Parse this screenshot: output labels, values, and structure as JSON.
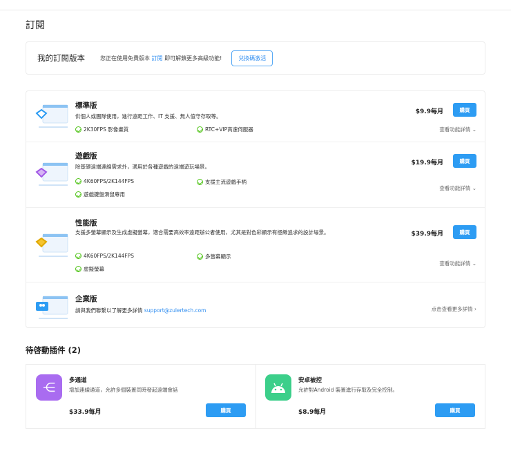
{
  "title": "訂閱",
  "subscription": {
    "heading": "我的訂閱版本",
    "text_before": "您正在使用免費版本",
    "link": "訂閱",
    "text_after": "即可解鎖更多高級功能!",
    "redeem": "兌換碼激活"
  },
  "plans": [
    {
      "name": "標準版",
      "desc": "供個人或團隊使用，進行遠距工作、IT 支援、無人值守存取等。",
      "features": [
        "2K30FPS 影像畫質",
        "RTC+VIP高速伺服器"
      ],
      "price": "$9.9每月",
      "buy": "購買",
      "more": "查看功能詳情",
      "color": "#2d9cf3"
    },
    {
      "name": "遊戲版",
      "desc": "除基礎遠端連線需求外，適用於各種遊戲的遠端遊玩場景。",
      "features": [
        "4K60FPS/2K144FPS",
        "支援主流遊戲手柄",
        "遊戲鍵盤滑鼠專用"
      ],
      "price": "$19.9每月",
      "buy": "購買",
      "more": "查看功能詳情",
      "color": "#a259e6"
    },
    {
      "name": "性能版",
      "desc": "支援多螢幕顯示及生成虛擬螢幕，適合需要高效率遠距辦公者使用，尤其是對色彩顯示有極緻追求的設計場景。",
      "features": [
        "4K60FPS/2K144FPS",
        "多螢幕顯示",
        "虛擬螢幕"
      ],
      "price": "$39.9每月",
      "buy": "購買",
      "more": "查看功能詳情",
      "color": "#f5c431"
    }
  ],
  "enterprise": {
    "name": "企業版",
    "desc": "請與我們聯繫以了解更多詳情",
    "email": "support@zulertech.com",
    "more": "点击查看更多詳情"
  },
  "plugins_heading": "待啓動插件 (2)",
  "plugins": [
    {
      "name": "多通道",
      "desc": "增加連線通道，允許多個裝置同時發起遠端會話",
      "price": "$33.9每月",
      "buy": "購買",
      "color": "#a96cf0"
    },
    {
      "name": "安卓被控",
      "desc": "允許對Android 裝置進行存取及完全控制。",
      "price": "$8.9每月",
      "buy": "購買",
      "color": "#3ccf8a"
    }
  ]
}
